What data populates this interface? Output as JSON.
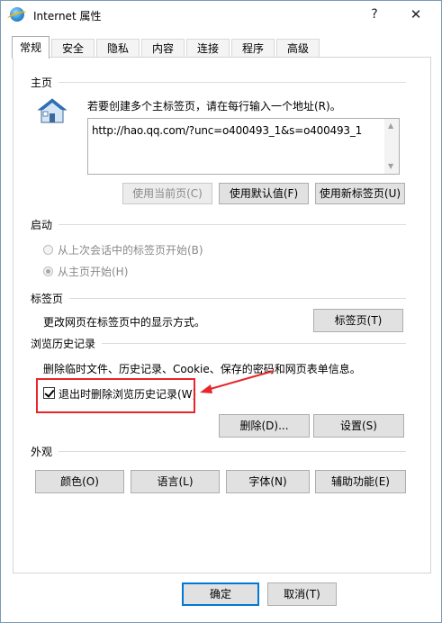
{
  "window": {
    "title": "Internet 属性",
    "help_label": "?",
    "close_label": "✕"
  },
  "tabs": [
    {
      "label": "常规",
      "active": true
    },
    {
      "label": "安全"
    },
    {
      "label": "隐私"
    },
    {
      "label": "内容"
    },
    {
      "label": "连接"
    },
    {
      "label": "程序"
    },
    {
      "label": "高级"
    }
  ],
  "homepage": {
    "section_title": "主页",
    "instruction": "若要创建多个主标签页，请在每行输入一个地址(R)。",
    "url_value": "http://hao.qq.com/?unc=o400493_1&s=o400493_1",
    "btn_use_current": "使用当前页(C)",
    "btn_use_default": "使用默认值(F)",
    "btn_use_new_tab": "使用新标签页(U)"
  },
  "startup": {
    "section_title": "启动",
    "option_last_session": "从上次会话中的标签页开始(B)",
    "option_home": "从主页开始(H)"
  },
  "tabs_section": {
    "section_title": "标签页",
    "description": "更改网页在标签页中的显示方式。",
    "btn_tabs": "标签页(T)"
  },
  "history": {
    "section_title": "浏览历史记录",
    "description": "删除临时文件、历史记录、Cookie、保存的密码和网页表单信息。",
    "checkbox_label": "退出时删除浏览历史记录(W)",
    "checkbox_checked": true,
    "btn_delete": "删除(D)...",
    "btn_settings": "设置(S)"
  },
  "appearance": {
    "section_title": "外观",
    "btn_colors": "颜色(O)",
    "btn_languages": "语言(L)",
    "btn_fonts": "字体(N)",
    "btn_accessibility": "辅助功能(E)"
  },
  "footer": {
    "btn_ok": "确定",
    "btn_cancel": "取消(T)"
  },
  "colors": {
    "highlight_red": "#e8262a",
    "primary_blue": "#0078d7"
  }
}
